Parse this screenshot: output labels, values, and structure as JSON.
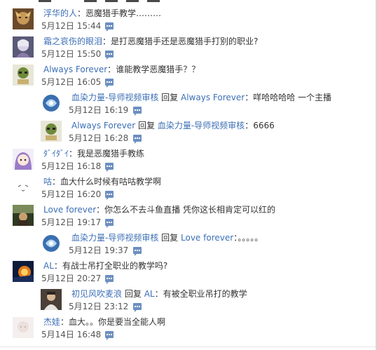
{
  "comments": [
    {
      "user": "浮华的人",
      "sep": "：",
      "text": "恶魔猎手教学………",
      "time": "5月12日 15:44"
    },
    {
      "user": "霜之哀伤的眼泪",
      "sep": "：",
      "text": "是打恶魔猎手还是恶魔猎手打别的职业?",
      "time": "5月12日 15:50"
    },
    {
      "user": "Always Forever",
      "sep": "：",
      "text": "谁能教学恶魔猎手？？",
      "time": "5月12日 16:05"
    },
    {
      "user": "血染力量-导师视频审核",
      "reply_word": "回复",
      "reply_to": "Always Forever",
      "sep": "：",
      "text": "咩哈哈哈哈 一个主播",
      "time": "5月12日 16:19"
    },
    {
      "user": "Always Forever",
      "reply_word": "回复",
      "reply_to": "血染力量-导师视频审核",
      "sep": "：",
      "text": "6666",
      "time": "5月12日 16:28"
    },
    {
      "user": "ﾀﾞｲﾀﾞｲ",
      "sep": "：",
      "text": "我是恶魔猎手教练",
      "time": "5月12日 16:18"
    },
    {
      "user": "咕",
      "sep": "：",
      "text": "血大什么时候有咕咕教学啊",
      "time": "5月12日 16:20"
    },
    {
      "user": "Love forever",
      "sep": "：",
      "text": "你怎么不去斗鱼直播 凭你这长相肯定可以红的",
      "time": "5月12日 19:17"
    },
    {
      "user": "血染力量-导师视频审核",
      "reply_word": "回复",
      "reply_to": "Love forever",
      "sep": "：",
      "text": "。。。。。",
      "time": "5月12日 19:37"
    },
    {
      "user": "AL",
      "sep": "：",
      "text": "有战士吊打全职业的教学吗?",
      "time": "5月12日 20:27"
    },
    {
      "user": "初见风吹麦浪",
      "reply_word": "回复",
      "reply_to": "AL",
      "sep": "：",
      "text": "有被全职业吊打的教学",
      "time": "5月12日 23:12"
    },
    {
      "user": "杰娃",
      "sep": "：",
      "text": "血大。。你是要当全能人啊",
      "time": "5月14日 16:48"
    }
  ],
  "colors": {
    "link": "#3c6fb6",
    "text": "#333333",
    "meta": "#555555",
    "reply_icon": "#6d8fc1"
  }
}
